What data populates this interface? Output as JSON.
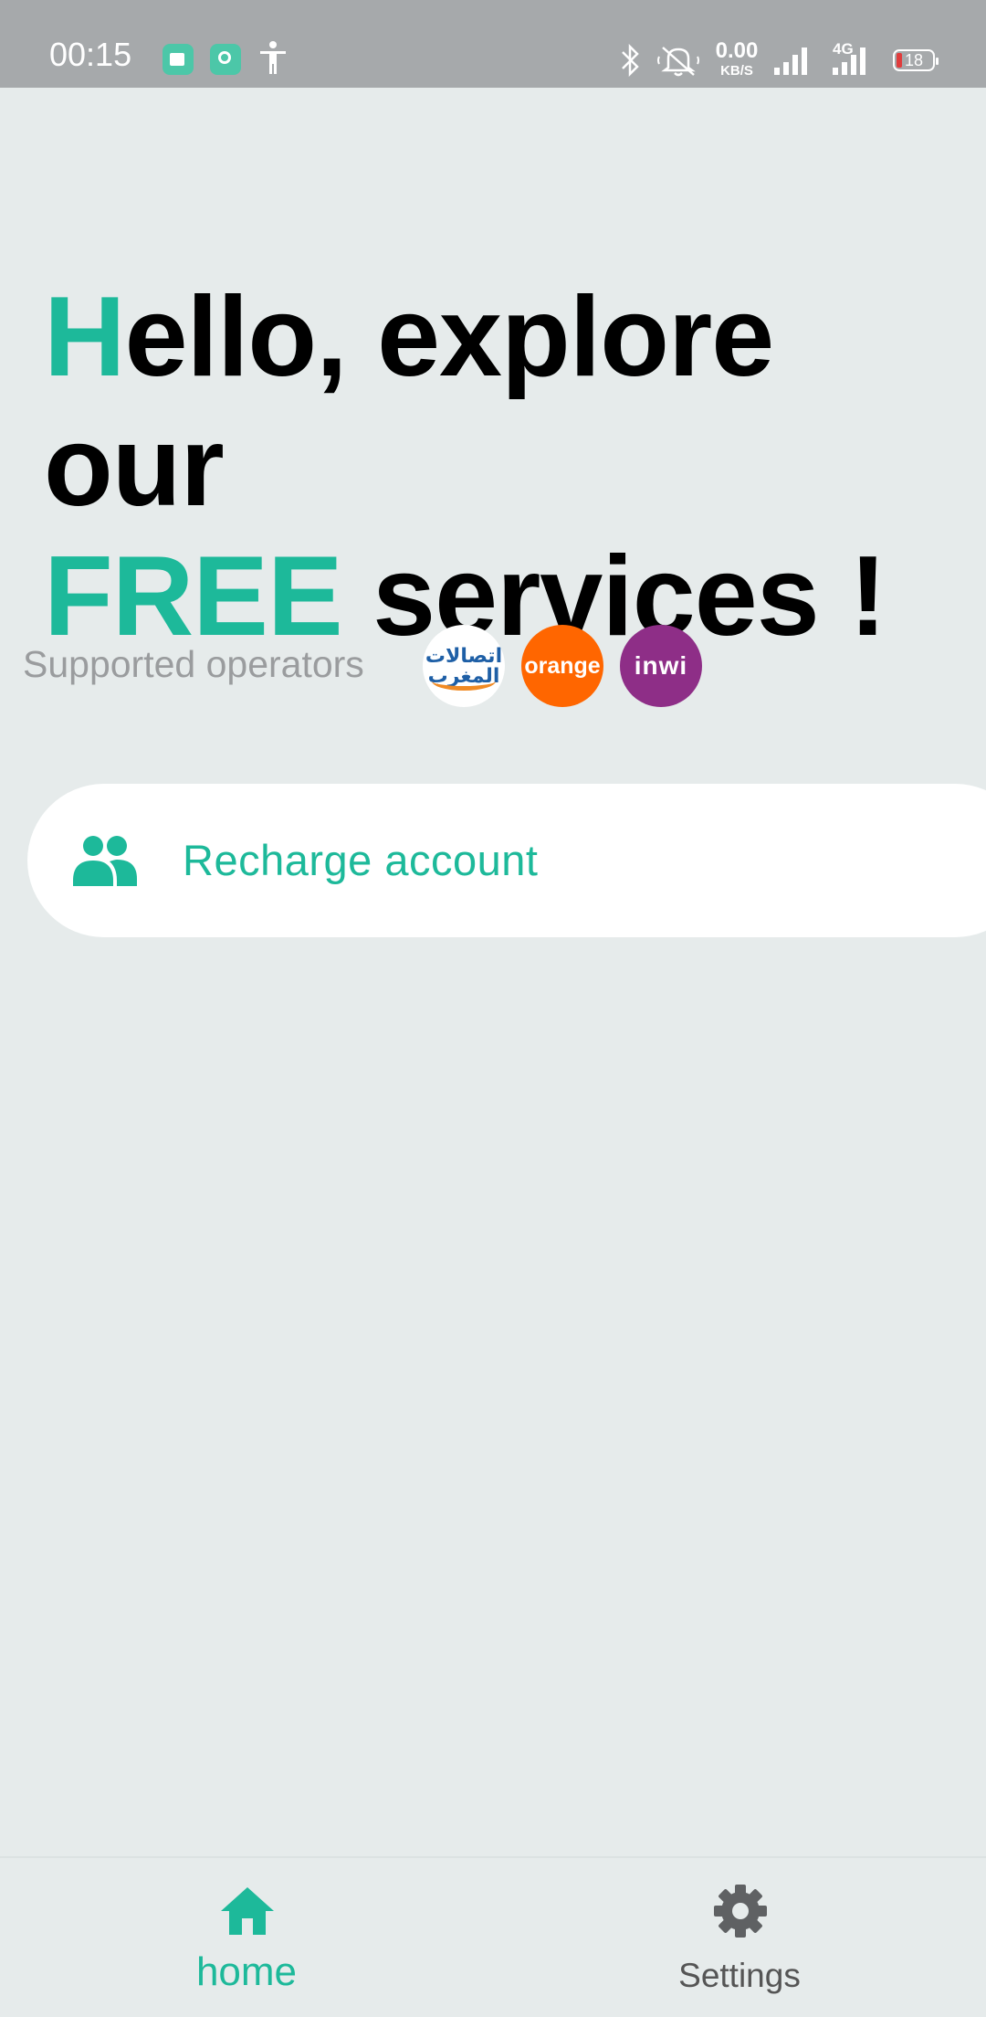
{
  "status_bar": {
    "time": "00:15",
    "net_speed_value": "0.00",
    "net_speed_unit": "KB/S",
    "network_type": "4G",
    "battery_level": "18",
    "icons": [
      "app-notification-icon",
      "app-notification-icon",
      "accessibility-icon",
      "bluetooth-icon",
      "mute-icon",
      "signal-icon",
      "signal-icon",
      "battery-icon"
    ]
  },
  "hero": {
    "line1_accent": "H",
    "line1_rest": "ello, explore our",
    "line2_accent": "FREE",
    "line2_rest": " services !"
  },
  "operators": {
    "label": "Supported operators",
    "items": [
      {
        "name": "iam",
        "logo_text": "اتصالات المغرب",
        "color": "#1E5FA6"
      },
      {
        "name": "orange",
        "logo_text": "orange",
        "color": "#FF6600"
      },
      {
        "name": "inwi",
        "logo_text": "inwi",
        "color": "#8E2E87"
      }
    ]
  },
  "actions": {
    "recharge_label": "Recharge account",
    "recharge_icon": "people-icon"
  },
  "bottom_nav": {
    "home_label": "home",
    "settings_label": "Settings",
    "active": "home"
  },
  "colors": {
    "accent": "#1DB99A",
    "background": "#E6EBEB",
    "status_bar": "#A6A9AB"
  }
}
